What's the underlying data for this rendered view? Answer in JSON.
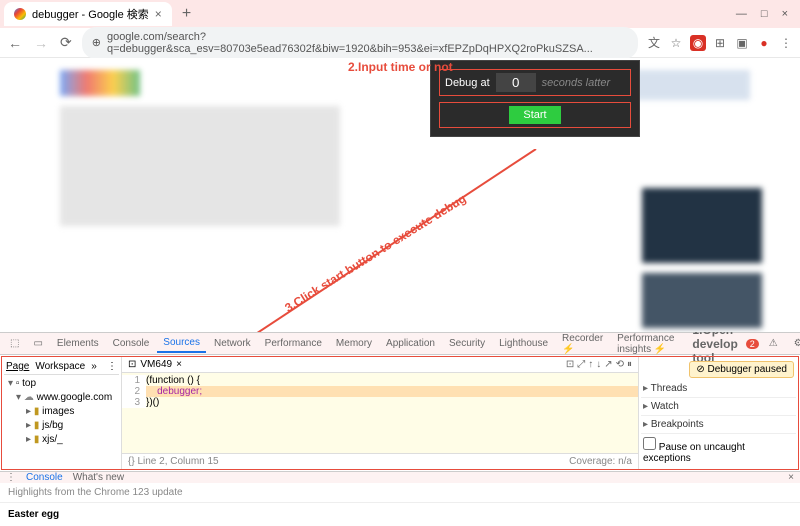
{
  "window": {
    "title": "debugger - Google 検索",
    "minimize": "—",
    "maximize": "□",
    "close": "×",
    "newtab": "+"
  },
  "toolbar": {
    "back": "←",
    "forward": "→",
    "reload": "⟳",
    "secure": "⊕",
    "url": "google.com/search?q=debugger&sca_esv=80703e5ead76302f&biw=1920&bih=953&ei=xfEPZpDqHPXQ2roPkuSZSA...",
    "translate": "文",
    "star": "☆",
    "ext1": "◉",
    "puzzle": "⊞",
    "menu": "⋮",
    "avatar": "●"
  },
  "annotations": {
    "a1": "2.Input time or not",
    "a2": "3.Click start button to execute debug",
    "a3": "1.Open develop tool"
  },
  "panel": {
    "label": "Debug at",
    "value": "0",
    "suffix": "seconds latter",
    "start": "Start"
  },
  "devtools": {
    "tabs": [
      "Elements",
      "Console",
      "Sources",
      "Network",
      "Performance",
      "Memory",
      "Application",
      "Security",
      "Lighthouse",
      "Recorder ⚡",
      "Performance insights ⚡"
    ],
    "active": "Sources",
    "err": "2",
    "warn": "⚠",
    "left": {
      "page": "Page",
      "workspace": "Workspace",
      "more": "»"
    },
    "tree": {
      "top": "top",
      "domain": "www.google.com",
      "folders": [
        "images",
        "js/bg",
        "xjs/_"
      ]
    },
    "file": {
      "name": "VM649",
      "close": "×",
      "icons": [
        "⊡",
        "⤢",
        "⫶",
        "↑",
        "↓",
        "↗",
        "⟲",
        "⏸"
      ]
    },
    "code": {
      "l1": "(function () {",
      "l2": "debugger;",
      "l3": "})()"
    },
    "status": {
      "left": "{} Line 2, Column 15",
      "right": "Coverage: n/a"
    },
    "right": {
      "paused": "⊘ Debugger paused",
      "threads": "Threads",
      "watch": "Watch",
      "bp": "Breakpoints",
      "pause": "Pause on uncaught exceptions"
    }
  },
  "drawer": {
    "console": "Console",
    "whatsnew": "What's new",
    "close": "×"
  },
  "bottom": {
    "hl": "Highlights from the Chrome 123 update",
    "egg": "Easter egg"
  }
}
